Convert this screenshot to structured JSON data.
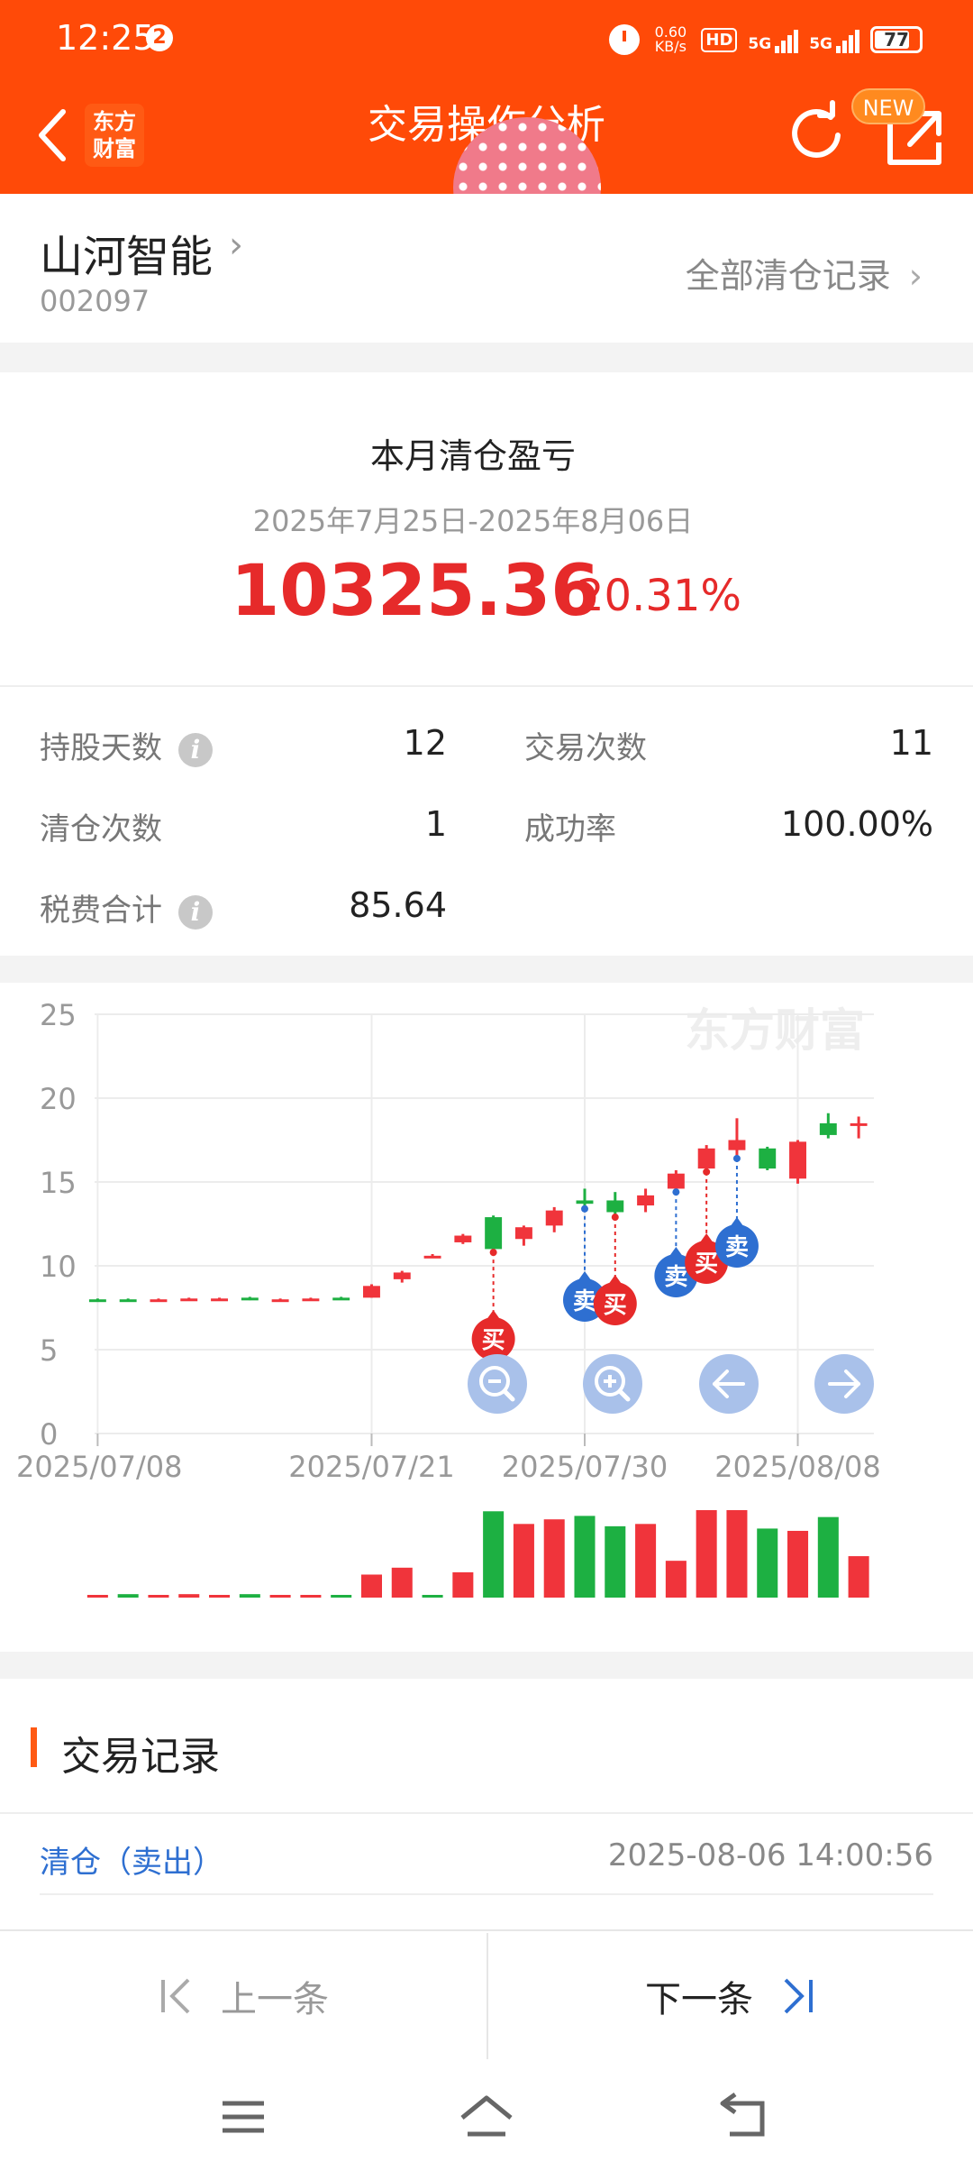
{
  "status_bar": {
    "time": "12:25",
    "notification_count": "2",
    "net_speed_value": "0.60",
    "net_speed_unit": "KB/s",
    "hd_label": "HD",
    "signal1_label": "5G",
    "signal2_label": "5G",
    "battery": "77"
  },
  "nav": {
    "logo_line1": "东方",
    "logo_line2": "财富",
    "title": "交易操作分析",
    "new_badge": "NEW"
  },
  "stock": {
    "name": "山河智能",
    "code": "002097",
    "all_records_label": "全部清仓记录"
  },
  "summary": {
    "title": "本月清仓盈亏",
    "range": "2025年7月25日-2025年8月06日",
    "profit": "10325.36",
    "percent": "20.31%"
  },
  "stats": {
    "hold_days_label": "持股天数",
    "hold_days_value": "12",
    "trade_count_label": "交易次数",
    "trade_count_value": "11",
    "clear_count_label": "清仓次数",
    "clear_count_value": "1",
    "success_rate_label": "成功率",
    "success_rate_value": "100.00%",
    "fees_label": "税费合计",
    "fees_value": "85.64"
  },
  "chart_data": {
    "type": "candlestick",
    "watermark": "东方财富",
    "ylim": [
      0,
      25
    ],
    "y_ticks": [
      "25",
      "20",
      "15",
      "10",
      "5",
      "0"
    ],
    "x_tick_labels": [
      "2025/07/08",
      "2025/07/21",
      "2025/07/30",
      "2025/08/08"
    ],
    "x_tick_index": [
      0,
      9,
      16,
      23
    ],
    "candles": [
      {
        "o": 8.0,
        "c": 8.0,
        "h": 8.05,
        "l": 7.95,
        "up": false
      },
      {
        "o": 8.0,
        "c": 8.0,
        "h": 8.05,
        "l": 7.95,
        "up": false
      },
      {
        "o": 7.95,
        "c": 8.0,
        "h": 8.05,
        "l": 7.9,
        "up": true
      },
      {
        "o": 8.0,
        "c": 8.05,
        "h": 8.1,
        "l": 7.95,
        "up": true
      },
      {
        "o": 8.05,
        "c": 8.05,
        "h": 8.1,
        "l": 8.0,
        "up": true
      },
      {
        "o": 8.1,
        "c": 8.0,
        "h": 8.15,
        "l": 7.95,
        "up": false
      },
      {
        "o": 8.0,
        "c": 8.0,
        "h": 8.05,
        "l": 7.95,
        "up": true
      },
      {
        "o": 8.0,
        "c": 8.05,
        "h": 8.1,
        "l": 7.95,
        "up": true
      },
      {
        "o": 8.1,
        "c": 8.1,
        "h": 8.15,
        "l": 8.05,
        "up": false
      },
      {
        "o": 8.1,
        "c": 8.8,
        "h": 8.9,
        "l": 8.1,
        "up": true
      },
      {
        "o": 9.2,
        "c": 9.6,
        "h": 9.7,
        "l": 9.0,
        "up": true
      },
      {
        "o": 10.6,
        "c": 10.6,
        "h": 10.7,
        "l": 10.5,
        "up": true
      },
      {
        "o": 11.4,
        "c": 11.8,
        "h": 11.9,
        "l": 11.3,
        "up": true
      },
      {
        "o": 12.9,
        "c": 11.0,
        "h": 13.0,
        "l": 10.8,
        "up": false
      },
      {
        "o": 11.6,
        "c": 12.3,
        "h": 12.4,
        "l": 11.2,
        "up": true
      },
      {
        "o": 12.4,
        "c": 13.3,
        "h": 13.5,
        "l": 12.0,
        "up": true
      },
      {
        "o": 13.9,
        "c": 13.7,
        "h": 14.6,
        "l": 13.4,
        "up": false
      },
      {
        "o": 13.9,
        "c": 13.2,
        "h": 14.4,
        "l": 12.9,
        "up": false
      },
      {
        "o": 13.6,
        "c": 14.2,
        "h": 14.6,
        "l": 13.2,
        "up": true
      },
      {
        "o": 14.6,
        "c": 15.5,
        "h": 15.7,
        "l": 14.4,
        "up": true
      },
      {
        "o": 15.8,
        "c": 17.0,
        "h": 17.2,
        "l": 15.6,
        "up": true
      },
      {
        "o": 16.9,
        "c": 17.5,
        "h": 18.8,
        "l": 16.4,
        "up": true
      },
      {
        "o": 17.0,
        "c": 15.8,
        "h": 17.1,
        "l": 15.7,
        "up": false
      },
      {
        "o": 15.2,
        "c": 17.4,
        "h": 17.5,
        "l": 14.9,
        "up": true
      },
      {
        "o": 18.5,
        "c": 17.8,
        "h": 19.1,
        "l": 17.6,
        "up": false
      },
      {
        "o": 18.5,
        "c": 18.5,
        "h": 18.9,
        "l": 17.6,
        "up": true
      }
    ],
    "volume": [
      2,
      3,
      2,
      3,
      2,
      3,
      2,
      2,
      2,
      20,
      26,
      2,
      22,
      75,
      64,
      68,
      71,
      62,
      64,
      32,
      76,
      76,
      60,
      58,
      70,
      36
    ],
    "volume_up": [
      true,
      false,
      true,
      true,
      true,
      false,
      true,
      true,
      false,
      true,
      true,
      false,
      true,
      false,
      true,
      true,
      false,
      false,
      true,
      true,
      true,
      true,
      false,
      true,
      false,
      true
    ],
    "trade_markers": [
      {
        "label": "买",
        "type": "buy",
        "candle": 13,
        "price": 10.8
      },
      {
        "label": "卖",
        "type": "sell",
        "candle": 16,
        "price": 13.4
      },
      {
        "label": "买",
        "type": "buy",
        "candle": 17,
        "price": 12.9
      },
      {
        "label": "卖",
        "type": "sell",
        "candle": 19,
        "price": 14.4
      },
      {
        "label": "买",
        "type": "buy",
        "candle": 20,
        "price": 15.6
      },
      {
        "label": "卖",
        "type": "sell",
        "candle": 21,
        "price": 16.4
      }
    ],
    "colors": {
      "up": "#f0343b",
      "down": "#1db042",
      "buy": "#e62a2a",
      "sell": "#2e6fd1",
      "grid": "#ececec",
      "axis_text": "#999999"
    }
  },
  "chart_controls": {
    "zoom_out": "zoom-out",
    "zoom_in": "zoom-in",
    "prev": "arrow-left",
    "next": "arrow-right"
  },
  "records": {
    "title": "交易记录",
    "type": "清仓（卖出）",
    "time": "2025-08-06 14:00:56"
  },
  "pager": {
    "prev_label": "上一条",
    "next_label": "下一条"
  }
}
